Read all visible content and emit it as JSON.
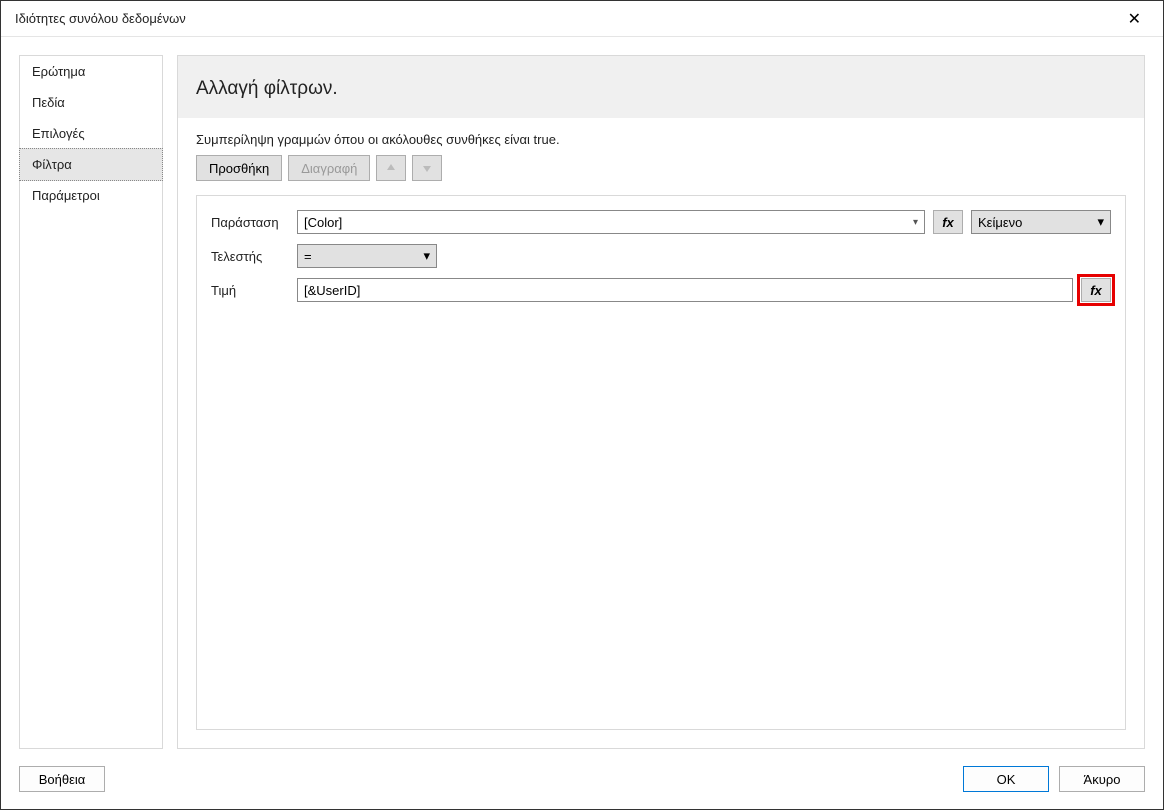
{
  "window": {
    "title": "Ιδιότητες συνόλου δεδομένων"
  },
  "sidebar": {
    "items": [
      {
        "label": "Ερώτημα"
      },
      {
        "label": "Πεδία"
      },
      {
        "label": "Επιλογές"
      },
      {
        "label": "Φίλτρα"
      },
      {
        "label": "Παράμετροι"
      }
    ],
    "selected_index": 3
  },
  "header": {
    "title": "Αλλαγή φίλτρων."
  },
  "instruction": "Συμπερίληψη γραμμών όπου οι ακόλουθες συνθήκες είναι true.",
  "toolbar": {
    "add_label": "Προσθήκη",
    "delete_label": "Διαγραφή"
  },
  "filter": {
    "labels": {
      "expression": "Παράσταση",
      "operator": "Τελεστής",
      "value": "Τιμή"
    },
    "expression_value": "[Color]",
    "type_value": "Κείμενο",
    "operator_value": "=",
    "value_value": "[&UserID]",
    "fx_label": "fx"
  },
  "footer": {
    "help_label": "Βοήθεια",
    "ok_label": "OK",
    "cancel_label": "Άκυρο"
  }
}
